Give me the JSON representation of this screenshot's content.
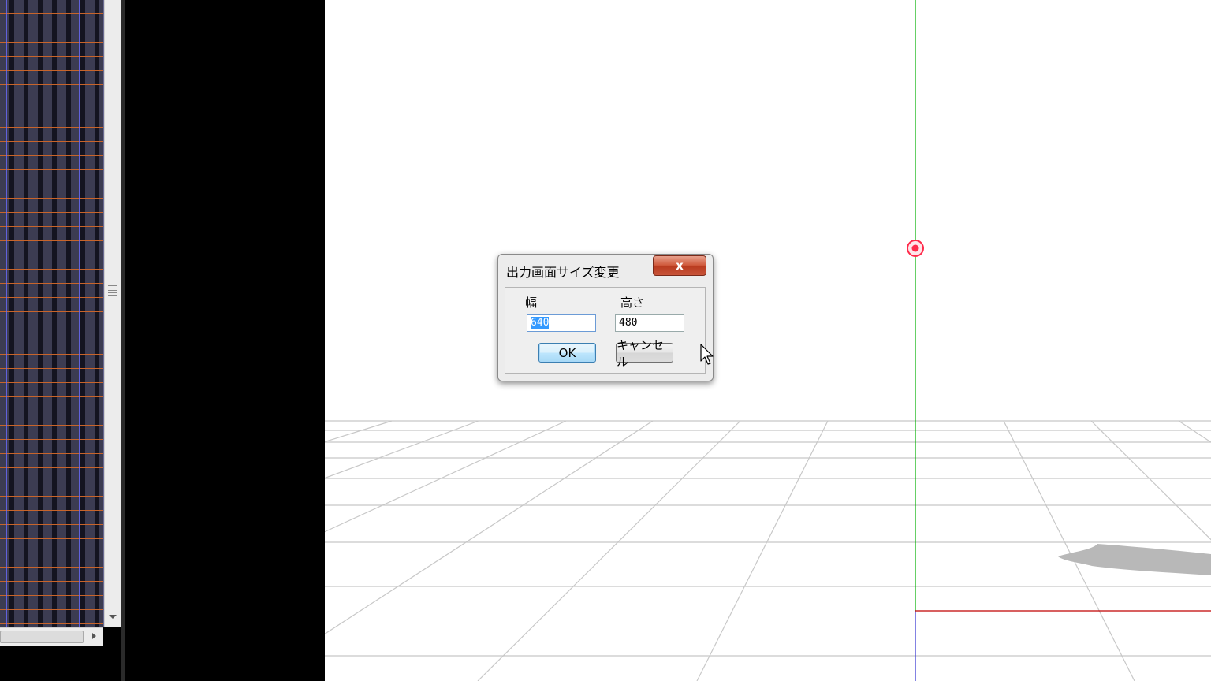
{
  "dialog": {
    "title": "出力画面サイズ変更",
    "close_symbol": "x",
    "width_label": "幅",
    "height_label": "高さ",
    "width_value": "640",
    "height_value": "480",
    "ok_label": "OK",
    "cancel_label": "キャンセル"
  },
  "colors": {
    "viewport_background": "#ffffff",
    "grid_line": "#c8c8c8",
    "y_axis": "#00b000",
    "x_axis": "#c00000",
    "z_axis": "#3030d0",
    "center_marker": "#ff2a4a",
    "timeline_row_line": "#c8642a"
  },
  "icons": {
    "center_marker": "target-icon",
    "cursor": "mouse-pointer-icon"
  }
}
